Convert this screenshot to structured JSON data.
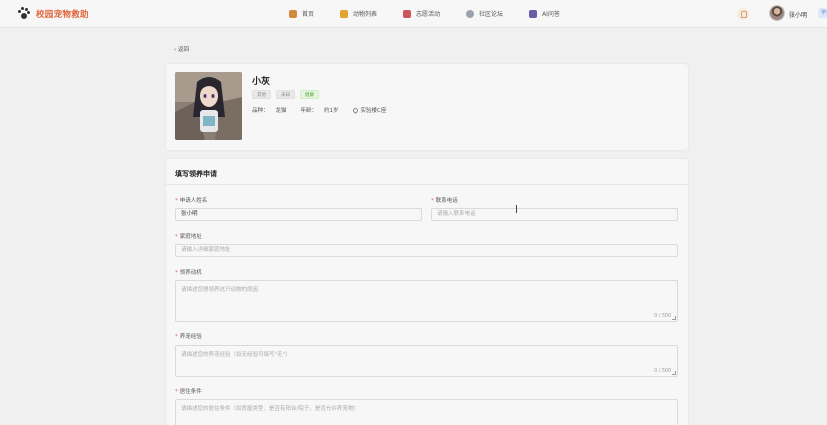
{
  "brand": {
    "name": "校园宠物救助",
    "logo_icon": "paw-icon"
  },
  "nav": [
    {
      "label": "首页",
      "icon": "home-icon",
      "color": "#d48a3c"
    },
    {
      "label": "动物列表",
      "icon": "list-icon",
      "color": "#e0a431"
    },
    {
      "label": "志愿活动",
      "icon": "clipboard-icon",
      "color": "#c9565a"
    },
    {
      "label": "社区论坛",
      "icon": "chat-icon",
      "color": "#9aa3ad"
    },
    {
      "label": "AI问答",
      "icon": "robot-icon",
      "color": "#6b5aa6"
    }
  ],
  "user": {
    "name": "张小明",
    "tag": "学生"
  },
  "back_label": "返回",
  "pet": {
    "name": "小灰",
    "tags": [
      "其他",
      "未知",
      "健康"
    ],
    "breed_label": "品种：",
    "breed": "龙猫",
    "age_label": "年龄：",
    "age": "约1岁",
    "location": "实验楼C座"
  },
  "form": {
    "title": "填写领养申请",
    "name_label": "申请人姓名",
    "name_value": "张小明",
    "phone_label": "联系电话",
    "phone_placeholder": "请输入联系电话",
    "address_label": "家庭地址",
    "address_placeholder": "请输入详细家庭地址",
    "motive_label": "领养动机",
    "motive_placeholder": "请描述您想领养这只动物的原因",
    "motive_counter": "0 / 500",
    "experience_label": "养宠经验",
    "experience_placeholder": "请描述您的养宠经验（如无经验可填写\"无\"）",
    "experience_counter": "0 / 500",
    "living_label": "居住条件",
    "living_placeholder": "请描述您的居住条件（如房屋类型、是否有阳台/院子、是否允许养宠物）"
  },
  "colors": {
    "brand": "#e0653a",
    "required": "#e05a5a",
    "tag_green": "#5aa53e"
  }
}
